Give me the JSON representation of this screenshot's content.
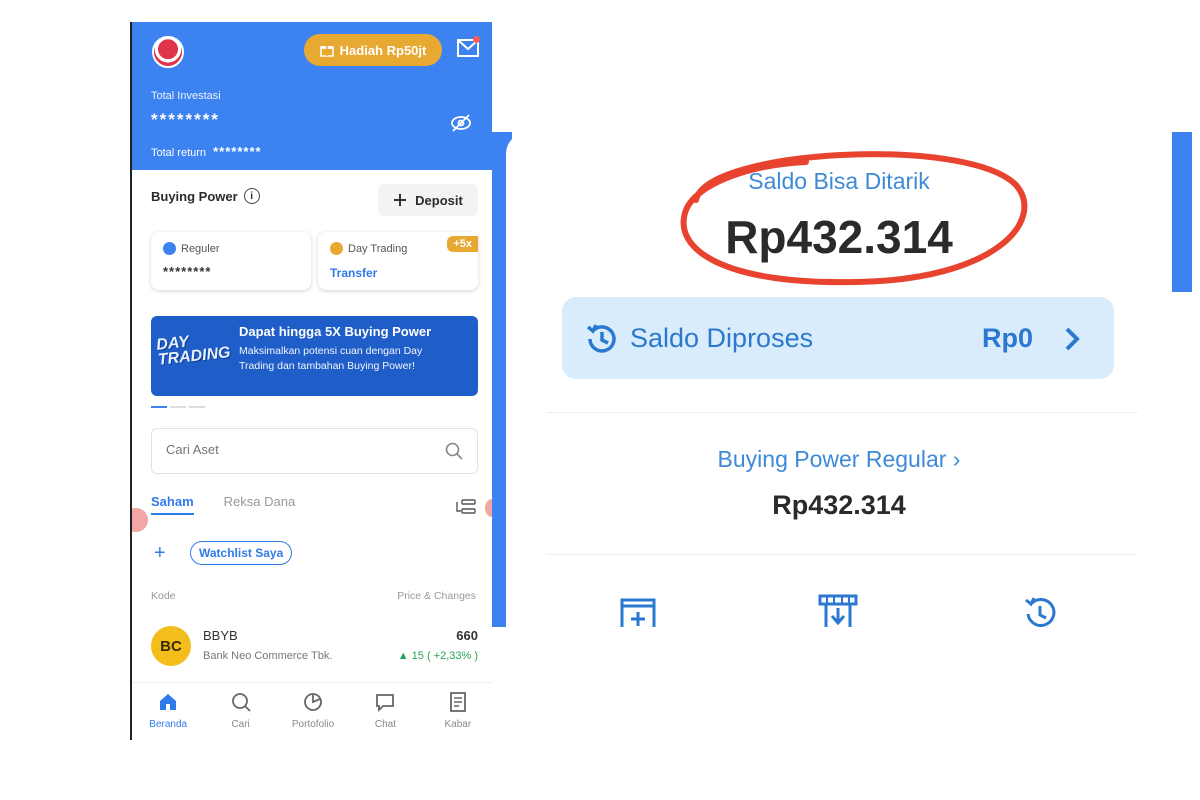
{
  "header": {
    "gift_label": "Hadiah Rp50jt",
    "total_investasi_label": "Total Investasi",
    "total_investasi_value": "********",
    "total_return_label": "Total return",
    "total_return_value": "********"
  },
  "buying_power": {
    "label": "Buying Power",
    "deposit_label": "Deposit",
    "reguler_label": "Reguler",
    "reguler_value": "********",
    "day_trading_label": "Day Trading",
    "transfer_label": "Transfer",
    "multiplier_badge": "+5x"
  },
  "promo": {
    "art_text_line1": "DAY",
    "art_text_line2": "TRADING",
    "title": "Dapat hingga 5X Buying Power",
    "description": "Maksimalkan potensi cuan dengan Day Trading dan tambahan Buying Power!"
  },
  "search": {
    "placeholder": "Cari Aset"
  },
  "tabs": [
    {
      "label": "Saham",
      "active": true
    },
    {
      "label": "Reksa Dana",
      "active": false
    }
  ],
  "watchlist_label": "Watchlist Saya",
  "table_headers": {
    "code": "Kode",
    "price": "Price & Changes"
  },
  "stock": {
    "logo_text": "BC",
    "code": "BBYB",
    "name": "Bank Neo Commerce Tbk.",
    "price": "660",
    "change": "▲ 15 ( +2,33% )"
  },
  "bottom_nav": [
    {
      "label": "Beranda",
      "icon": "home-icon",
      "active": true
    },
    {
      "label": "Cari",
      "icon": "search-icon",
      "active": false
    },
    {
      "label": "Portofolio",
      "icon": "pie-chart-icon",
      "active": false
    },
    {
      "label": "Chat",
      "icon": "chat-icon",
      "active": false
    },
    {
      "label": "Kabar",
      "icon": "news-icon",
      "active": false
    }
  ],
  "zoom": {
    "saldo_label": "Saldo Bisa Ditarik",
    "saldo_amount": "Rp432.314",
    "proses_label": "Saldo Diproses",
    "proses_value": "Rp0",
    "bp_regular_label": "Buying Power Regular",
    "bp_regular_value": "Rp432.314"
  },
  "colors": {
    "brand_blue": "#3d82f1",
    "gold": "#e7a931",
    "highlight_red": "#e8432f",
    "positive_green": "#27a25b"
  }
}
